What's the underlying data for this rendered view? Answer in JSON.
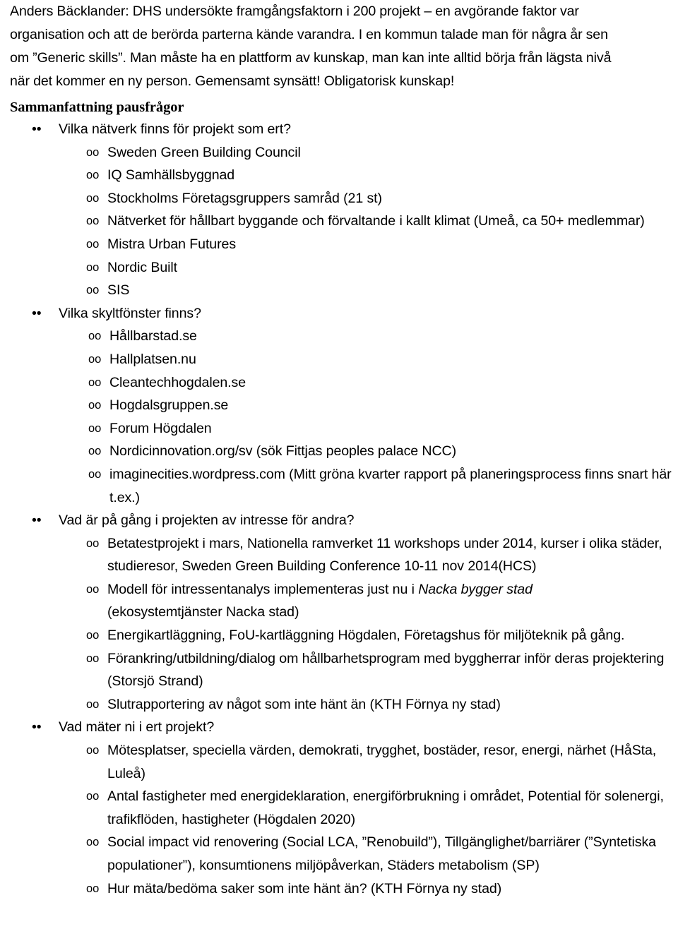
{
  "document": {
    "intro_paragraph": {
      "lines": [
        "Anders Bäcklander: DHS undersökte framgångsfaktorn i 200 projekt – en avgörande faktor var",
        "organisation och att de berörda parterna kände varandra. I en kommun talade man för några år sen",
        "om ”Generic skills”. Man måste ha en plattform av kunskap, man kan inte alltid börja från lägsta nivå",
        "när det kommer en ny person. Gemensamt synsätt! Obligatorisk kunskap!"
      ]
    },
    "heading": "Sammanfattning pausfrågor",
    "bullet_glyphs": {
      "level1": "•",
      "level2": "o"
    },
    "sections": [
      {
        "question": "Vilka nätverk finns för projekt som ert?",
        "answers": [
          "Sweden Green Building Council",
          "IQ Samhällsbyggnad",
          "Stockholms Företagsgruppers samråd (21 st)",
          "Nätverket för hållbart byggande och förvaltande i kallt klimat (Umeå, ca 50+ medlemmar)",
          "Mistra Urban Futures",
          "Nordic Built",
          "SIS"
        ]
      },
      {
        "question": "Vilka skyltfönster finns?",
        "answers": [
          "Hållbarstad.se",
          "Hallplatsen.nu",
          "Cleantechhogdalen.se",
          "Hogdalsgruppen.se",
          "Forum Högdalen",
          "Nordicinnovation.org/sv (sök Fittjas peoples palace NCC)",
          "imaginecities.wordpress.com (Mitt gröna kvarter rapport på planeringsprocess finns snart här t.ex.)"
        ]
      },
      {
        "question": "Vad är på gång i projekten av intresse för andra?",
        "answers": [
          "Betatestprojekt i mars, Nationella ramverket 11 workshops under 2014, kurser i olika städer, studieresor, Sweden Green Building Conference 10-11 nov 2014(HCS)",
          "Modell för intressentanalys implementeras just nu i ",
          "Energikartläggning, FoU-kartläggning Högdalen, Företagshus för miljöteknik på gång.",
          "Förankring/utbildning/dialog om hållbarhetsprogram med byggherrar inför deras projektering (Storsjö Strand)",
          "Slutrapportering av något som inte hänt än (KTH Förnya ny stad)"
        ],
        "answer_2_italic": "Nacka bygger stad",
        "answer_2_tail": " (ekosystemtjänster Nacka stad)"
      },
      {
        "question": "Vad mäter ni i ert projekt?",
        "answers": [
          "Mötesplatser, speciella värden, demokrati, trygghet, bostäder, resor, energi, närhet (HåSta, Luleå)",
          "Antal fastigheter med energideklaration, energiförbrukning i området, Potential för solenergi, trafikflöden, hastigheter (Högdalen 2020)",
          "Social impact vid renovering (Social LCA, ”Renobuild”), Tillgänglighet/barriärer (”Syntetiska populationer”), konsumtionens miljöpåverkan, Städers metabolism (SP)",
          "Hur mäta/bedöma saker som inte hänt än? (KTH Förnya ny stad)"
        ]
      }
    ]
  }
}
